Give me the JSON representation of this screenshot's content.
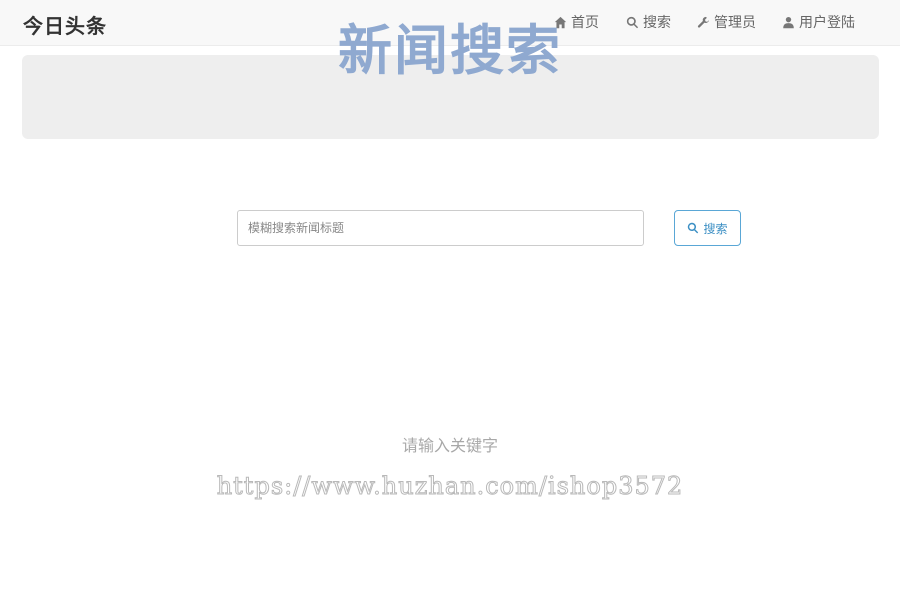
{
  "navbar": {
    "brand": "今日头条",
    "items": [
      {
        "label": "首页",
        "icon": "home-icon"
      },
      {
        "label": "搜索",
        "icon": "search-icon"
      },
      {
        "label": "管理员",
        "icon": "wrench-icon"
      },
      {
        "label": "用户登陆",
        "icon": "user-icon"
      }
    ]
  },
  "hero": {
    "title": "新闻搜索"
  },
  "search": {
    "placeholder": "模糊搜索新闻标题",
    "button_label": "搜索"
  },
  "hint": "请输入关键字",
  "watermark": "https://www.huzhan.com/ishop3572",
  "colors": {
    "hero_text": "#8fa9d0",
    "button_accent": "#3b8fc4"
  }
}
